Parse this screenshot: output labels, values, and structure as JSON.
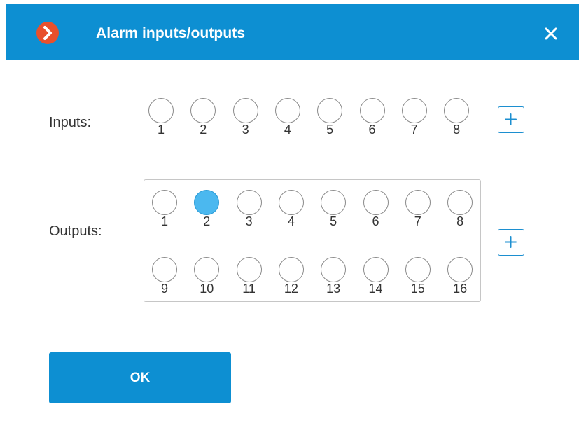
{
  "dialog": {
    "title": "Alarm inputs/outputs",
    "close_icon": "close-icon",
    "logo_icon": "app-logo-icon",
    "colors": {
      "accent": "#0d8fd2",
      "active_led": "#4bb8ef"
    }
  },
  "inputs": {
    "label": "Inputs:",
    "items": [
      {
        "num": "1",
        "active": false
      },
      {
        "num": "2",
        "active": false
      },
      {
        "num": "3",
        "active": false
      },
      {
        "num": "4",
        "active": false
      },
      {
        "num": "5",
        "active": false
      },
      {
        "num": "6",
        "active": false
      },
      {
        "num": "7",
        "active": false
      },
      {
        "num": "8",
        "active": false
      }
    ],
    "add_label": "+"
  },
  "outputs": {
    "label": "Outputs:",
    "items": [
      {
        "num": "1",
        "active": false
      },
      {
        "num": "2",
        "active": true
      },
      {
        "num": "3",
        "active": false
      },
      {
        "num": "4",
        "active": false
      },
      {
        "num": "5",
        "active": false
      },
      {
        "num": "6",
        "active": false
      },
      {
        "num": "7",
        "active": false
      },
      {
        "num": "8",
        "active": false
      },
      {
        "num": "9",
        "active": false
      },
      {
        "num": "10",
        "active": false
      },
      {
        "num": "11",
        "active": false
      },
      {
        "num": "12",
        "active": false
      },
      {
        "num": "13",
        "active": false
      },
      {
        "num": "14",
        "active": false
      },
      {
        "num": "15",
        "active": false
      },
      {
        "num": "16",
        "active": false
      }
    ],
    "add_label": "+"
  },
  "footer": {
    "ok_label": "OK"
  }
}
